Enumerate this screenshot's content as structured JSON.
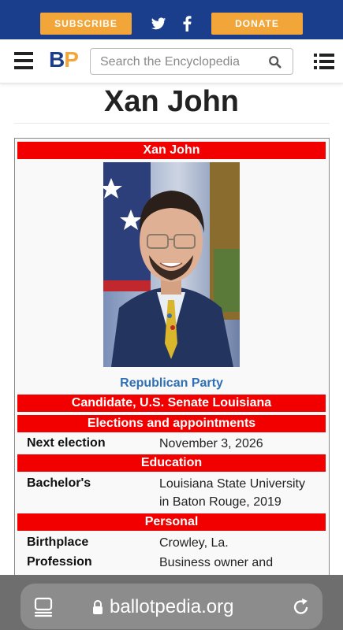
{
  "header": {
    "subscribe_label": "SUBSCRIBE",
    "donate_label": "DONATE",
    "social_icons": [
      "twitter-icon",
      "facebook-icon"
    ]
  },
  "nav": {
    "logo_b": "B",
    "logo_p": "P",
    "search_placeholder": "Search the Encyclopedia"
  },
  "page": {
    "title": "Xan John"
  },
  "infobox": {
    "name": "Xan John",
    "party": "Republican Party",
    "office": "Candidate, U.S. Senate Louisiana",
    "sections": {
      "elections": "Elections and appointments",
      "education": "Education",
      "personal": "Personal"
    },
    "rows": {
      "next_election": {
        "label": "Next election",
        "value": "November 3, 2026"
      },
      "bachelors": {
        "label": "Bachelor's",
        "value_line1": "Louisiana State University",
        "value_line2": "in Baton Rouge, 2019"
      },
      "birthplace": {
        "label": "Birthplace",
        "value": "Crowley, La."
      },
      "profession": {
        "label": "Profession",
        "value": "Business owner and"
      }
    }
  },
  "browser": {
    "url": "ballotpedia.org"
  },
  "colors": {
    "header_blue": "#1a3e8c",
    "accent_orange": "#f2a63a",
    "infobox_red": "#f20000",
    "party_blue": "#2f6fb5"
  }
}
